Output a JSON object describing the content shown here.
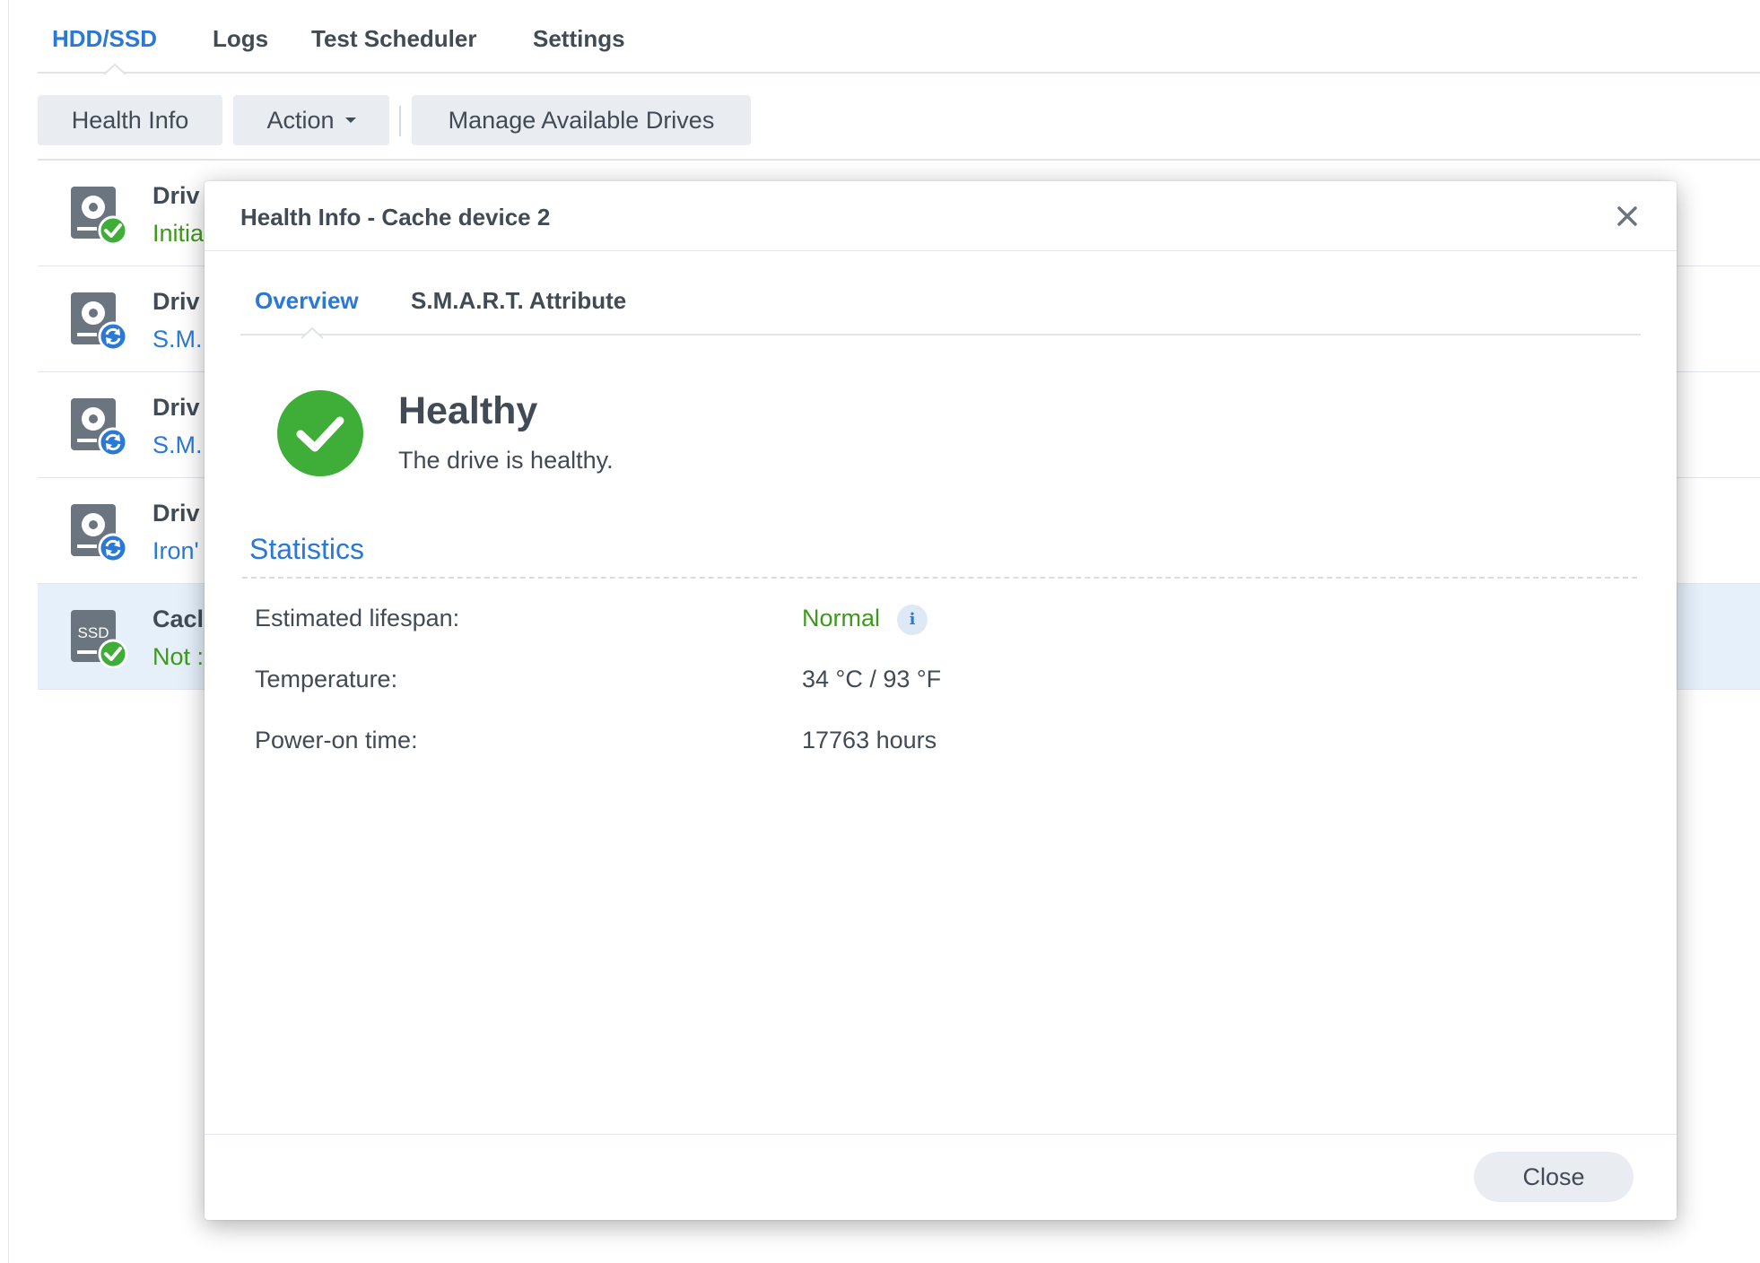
{
  "tabs": {
    "hdd_ssd": "HDD/SSD",
    "logs": "Logs",
    "scheduler": "Test Scheduler",
    "settings": "Settings"
  },
  "toolbar": {
    "health_info": "Health Info",
    "action": "Action",
    "manage_drives": "Manage Available Drives"
  },
  "drives": [
    {
      "title": "Driv",
      "status": "Initia",
      "status_color": "green",
      "icon": "hdd-check-icon"
    },
    {
      "title": "Driv",
      "status": "S.M.",
      "status_color": "blue",
      "icon": "hdd-sync-icon"
    },
    {
      "title": "Driv",
      "status": "S.M.",
      "status_color": "blue",
      "icon": "hdd-sync-icon"
    },
    {
      "title": "Driv",
      "status": "Iron'",
      "status_color": "blue",
      "icon": "hdd-sync-icon"
    },
    {
      "title": "Cacl",
      "status": "Not :",
      "status_color": "green",
      "icon": "ssd-check-icon",
      "icon_text": "SSD"
    }
  ],
  "modal": {
    "title": "Health Info - Cache device 2",
    "tabs": {
      "overview": "Overview",
      "smart": "S.M.A.R.T. Attribute"
    },
    "health": {
      "status": "Healthy",
      "description": "The drive is healthy."
    },
    "stats_title": "Statistics",
    "stats": {
      "lifespan_label": "Estimated lifespan:",
      "lifespan_value": "Normal",
      "temperature_label": "Temperature:",
      "temperature_value": "34 °C / 93 °F",
      "power_label": "Power-on time:",
      "power_value": "17763 hours"
    },
    "info_glyph": "i",
    "close_label": "Close"
  },
  "colors": {
    "accent": "#2a79d6",
    "success": "#3d9a1b",
    "check_green": "#3fae38",
    "text": "#414b55",
    "selected_row": "#e6f0fb"
  }
}
